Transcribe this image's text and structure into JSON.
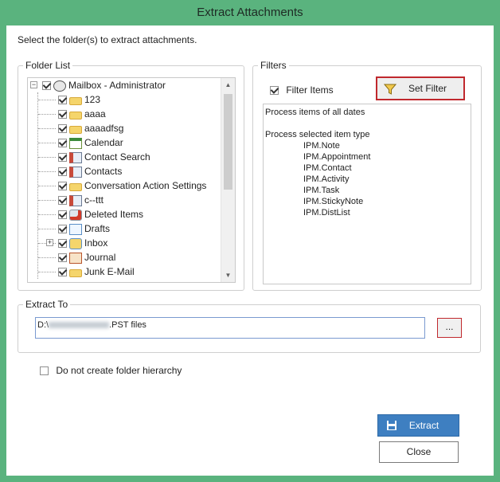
{
  "window": {
    "title": "Extract Attachments"
  },
  "instruction": "Select the folder(s) to extract attachments.",
  "folder_list": {
    "legend": "Folder List",
    "items": [
      {
        "label": "Mailbox - Administrator",
        "icon": "mailbox-icon",
        "level": 0,
        "expander": "−",
        "checked": true
      },
      {
        "label": "123",
        "icon": "folder-icon",
        "level": 1,
        "checked": true
      },
      {
        "label": "aaaa",
        "icon": "folder-icon",
        "level": 1,
        "checked": true
      },
      {
        "label": "aaaadfsg",
        "icon": "folder-icon",
        "level": 1,
        "checked": true
      },
      {
        "label": "Calendar",
        "icon": "calendar-icon",
        "level": 1,
        "checked": true
      },
      {
        "label": "Contact Search",
        "icon": "contact-card-icon",
        "level": 1,
        "checked": true
      },
      {
        "label": "Contacts",
        "icon": "contact-card-icon",
        "level": 1,
        "checked": true
      },
      {
        "label": "Conversation Action Settings",
        "icon": "folder-icon",
        "level": 1,
        "checked": true
      },
      {
        "label": "c--ttt",
        "icon": "contact-card-icon",
        "level": 1,
        "checked": true
      },
      {
        "label": "Deleted Items",
        "icon": "deleted-items-icon",
        "level": 1,
        "checked": true
      },
      {
        "label": "Drafts",
        "icon": "drafts-icon",
        "level": 1,
        "checked": true
      },
      {
        "label": "Inbox",
        "icon": "inbox-icon",
        "level": 1,
        "expander": "+",
        "checked": true
      },
      {
        "label": "Journal",
        "icon": "journal-icon",
        "level": 1,
        "checked": true
      },
      {
        "label": "Junk E-Mail",
        "icon": "folder-icon",
        "level": 1,
        "checked": true
      }
    ]
  },
  "filters": {
    "legend": "Filters",
    "filter_items_label": "Filter Items",
    "filter_items_checked": true,
    "set_filter_label": "Set Filter",
    "summary_heading_1": "Process items of all dates",
    "summary_heading_2": "Process selected item type",
    "item_types": [
      "IPM.Note",
      "IPM.Appointment",
      "IPM.Contact",
      "IPM.Activity",
      "IPM.Task",
      "IPM.StickyNote",
      "IPM.DistList"
    ]
  },
  "extract_to": {
    "legend": "Extract To",
    "path_prefix": "D:\\",
    "path_suffix": ".PST files",
    "browse_label": "..."
  },
  "options": {
    "no_hierarchy_label": "Do not create folder hierarchy",
    "no_hierarchy_checked": false
  },
  "buttons": {
    "extract_label": "Extract",
    "close_label": "Close"
  },
  "colors": {
    "frame": "#5ab37e",
    "primary_button": "#3e7fc1",
    "highlight_border": "#c0282d"
  }
}
